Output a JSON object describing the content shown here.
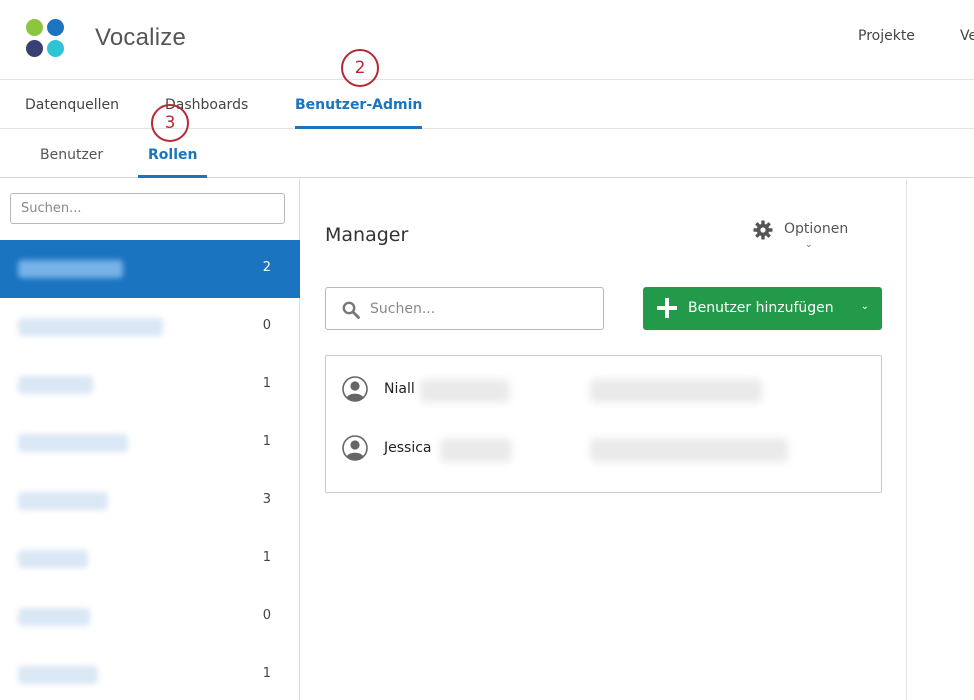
{
  "app": {
    "title": "Vocalize"
  },
  "topnav": {
    "items": [
      {
        "label": "Projekte"
      },
      {
        "label": "Ve"
      }
    ]
  },
  "tabs": [
    {
      "label": "Datenquellen"
    },
    {
      "label": "Dashboards"
    },
    {
      "label": "Benutzer-Admin",
      "active": true
    }
  ],
  "subtabs": [
    {
      "label": "Benutzer"
    },
    {
      "label": "Rollen",
      "active": true
    }
  ],
  "markers": {
    "m2": "2",
    "m3": "3"
  },
  "sidebar": {
    "search_placeholder": "Suchen...",
    "roles": [
      {
        "count": "2",
        "selected": true
      },
      {
        "count": "0"
      },
      {
        "count": "1"
      },
      {
        "count": "1"
      },
      {
        "count": "3"
      },
      {
        "count": "1"
      },
      {
        "count": "0"
      },
      {
        "count": "1"
      }
    ]
  },
  "main": {
    "title": "Manager",
    "options_label": "Optionen",
    "search_placeholder": "Suchen...",
    "add_button_label": "Benutzer hinzufügen",
    "users": [
      {
        "name": "Niall"
      },
      {
        "name": "Jessica"
      }
    ]
  },
  "colors": {
    "accent": "#1a74c0",
    "add_button": "#23994a",
    "marker": "#b72934"
  },
  "icons": {
    "gear": "gear-icon",
    "search": "search-icon",
    "plus": "plus-icon",
    "user": "user-avatar-icon"
  }
}
